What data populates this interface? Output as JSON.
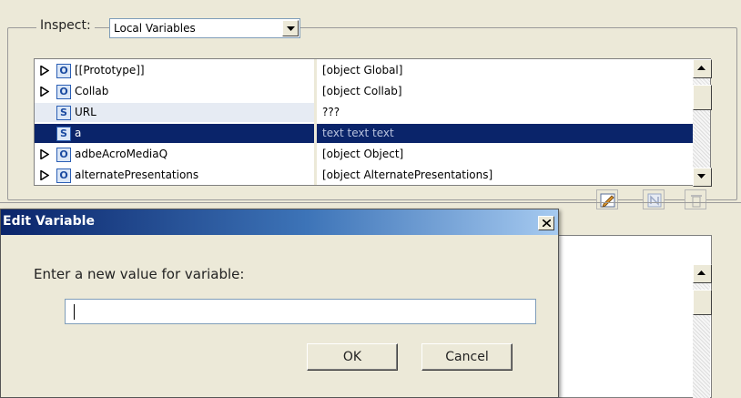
{
  "inspect": {
    "label": "Inspect:",
    "selected": "Local Variables"
  },
  "variables": [
    {
      "type": "O",
      "name": "[[Prototype]]",
      "value": "[object Global]",
      "expandable": true
    },
    {
      "type": "O",
      "name": "Collab",
      "value": "[object Collab]",
      "expandable": true
    },
    {
      "type": "S",
      "name": "URL",
      "value": "???",
      "expandable": false
    },
    {
      "type": "S",
      "name": "a",
      "value": "text text text",
      "expandable": false,
      "selected": true
    },
    {
      "type": "O",
      "name": "adbeAcroMediaQ",
      "value": "[object Object]",
      "expandable": true
    },
    {
      "type": "O",
      "name": "alternatePresentations",
      "value": "[object AlternatePresentations]",
      "expandable": true
    }
  ],
  "toolbar": {
    "icons": [
      "edit-variable-icon",
      "new-variable-icon",
      "delete-variable-icon"
    ]
  },
  "dialog": {
    "title": "Edit Variable",
    "prompt": "Enter a new value for variable:",
    "input_value": "",
    "ok_label": "OK",
    "cancel_label": "Cancel"
  },
  "colors": {
    "selection": "#0a246a",
    "badge_border": "#2b5fb5",
    "window_bg": "#ece9d8"
  }
}
